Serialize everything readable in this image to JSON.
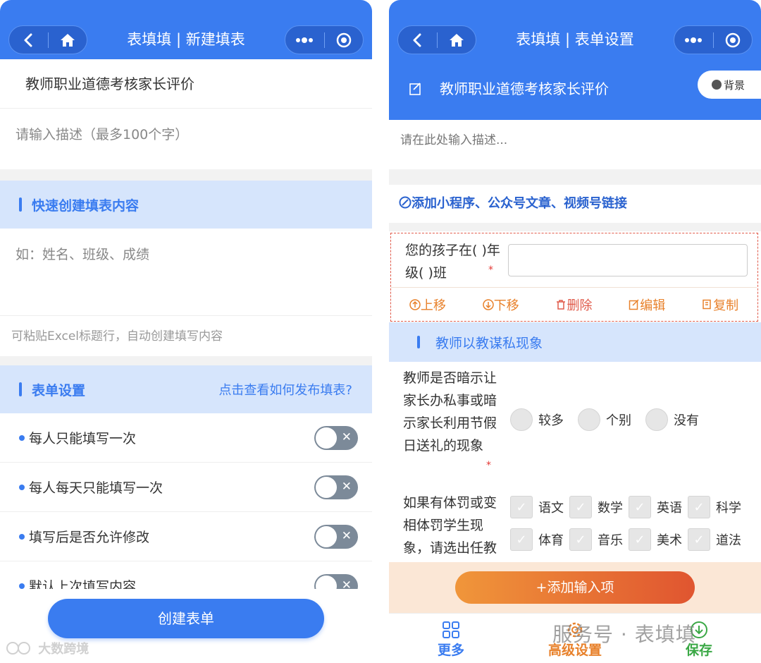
{
  "left": {
    "header_title": "表填填 | 新建填表",
    "form_title": "教师职业道德考核家长评价",
    "description_placeholder": "请输入描述（最多100个字）",
    "quick_create": {
      "title": "快速创建填表内容",
      "placeholder": "如：姓名、班级、成绩",
      "hint": "可粘贴Excel标题行，自动创建填写内容"
    },
    "settings": {
      "title": "表单设置",
      "help_link": "点击查看如何发布填表?",
      "items": [
        {
          "label": "每人只能填写一次",
          "enabled": false
        },
        {
          "label": "每人每天只能填写一次",
          "enabled": false
        },
        {
          "label": "填写后是否允许修改",
          "enabled": false
        },
        {
          "label": "默认上次填写内容",
          "enabled": false
        }
      ]
    },
    "create_button": "创建表单",
    "watermark": "大数跨境"
  },
  "right": {
    "header_title": "表填填 | 表单设置",
    "form_title": "教师职业道德考核家长评价",
    "background_button": "背景",
    "description_placeholder": "请在此处输入描述...",
    "add_link": "添加小程序、公众号文章、视频号链接",
    "q1": {
      "label": "您的孩子在( )年级( )班",
      "required_mark": "*",
      "actions": [
        "上移",
        "下移",
        "删除",
        "编辑",
        "复制"
      ]
    },
    "section": "教师以教谋私现象",
    "q2": {
      "label": "教师是否暗示让家长办私事或暗示家长利用节假日送礼的现象",
      "required_mark": "*",
      "options": [
        "较多",
        "个别",
        "没有"
      ]
    },
    "q3": {
      "label": "如果有体罚或变相体罚学生现象，请选出任教",
      "options": [
        "语文",
        "数学",
        "英语",
        "科学",
        "体育",
        "音乐",
        "美术",
        "道法"
      ]
    },
    "add_input_button": "添加输入项",
    "add_input_icon": "+",
    "tabs": [
      {
        "label": "更多",
        "color": "#3a7cf0"
      },
      {
        "label": "高级设置",
        "color": "#e8812b"
      },
      {
        "label": "保存",
        "color": "#3aa845"
      }
    ],
    "watermark": "服务号 · 表填填"
  },
  "colors": {
    "primary": "#3a7cf0",
    "orange": "#e8812b",
    "red": "#e05a4a",
    "green": "#3aa845"
  }
}
